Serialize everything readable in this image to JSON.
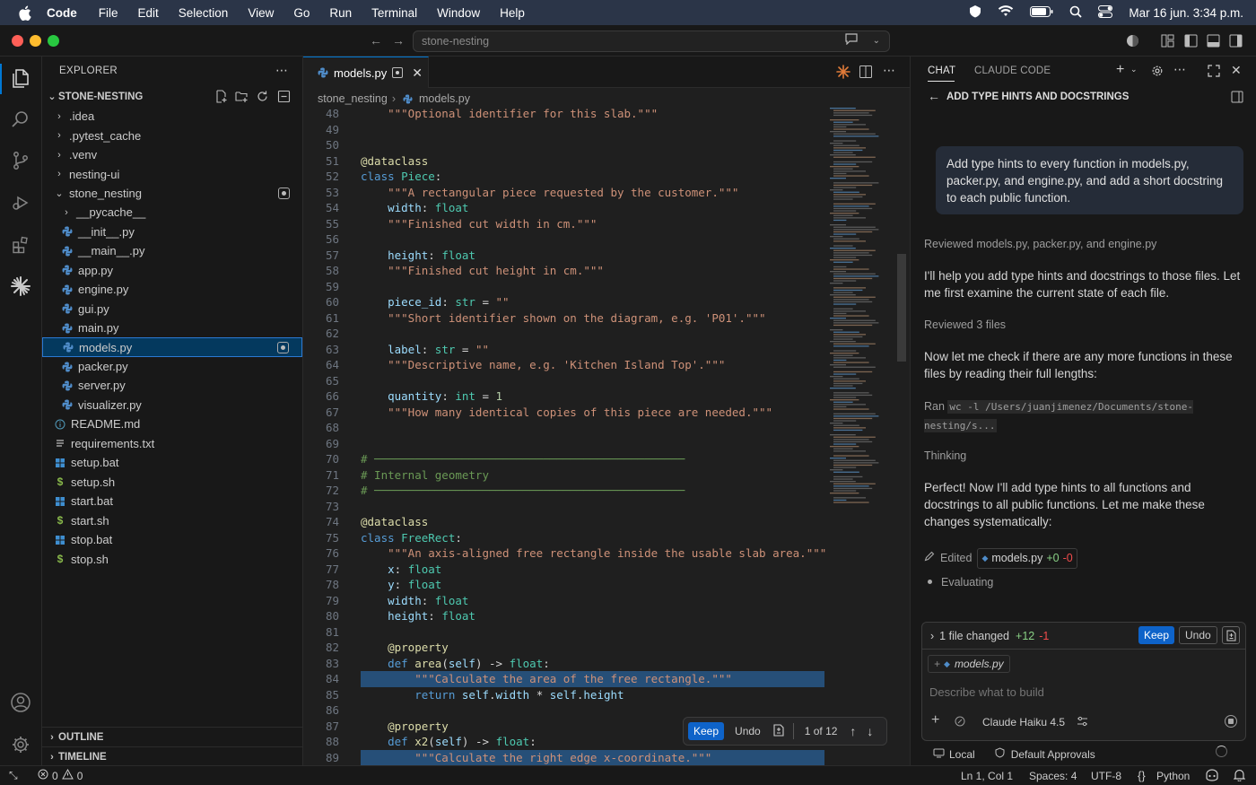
{
  "menubar": {
    "items": [
      "Code",
      "File",
      "Edit",
      "Selection",
      "View",
      "Go",
      "Run",
      "Terminal",
      "Window",
      "Help"
    ],
    "datetime": "Mar 16 jun.  3:34 p.m."
  },
  "titlebar": {
    "search": "stone-nesting"
  },
  "explorer": {
    "title": "EXPLORER",
    "root": "STONE-NESTING",
    "rows": [
      {
        "label": ".idea",
        "type": "folder",
        "depth": 1
      },
      {
        "label": ".pytest_cache",
        "type": "folder",
        "depth": 1
      },
      {
        "label": ".venv",
        "type": "folder",
        "depth": 1
      },
      {
        "label": "nesting-ui",
        "type": "folder",
        "depth": 1
      },
      {
        "label": "stone_nesting",
        "type": "folder-open",
        "depth": 1
      },
      {
        "label": "__pycache__",
        "type": "folder",
        "depth": 2
      },
      {
        "label": "__init__.py",
        "type": "py",
        "depth": 2
      },
      {
        "label": "__main__.py",
        "type": "py",
        "depth": 2
      },
      {
        "label": "app.py",
        "type": "py",
        "depth": 2
      },
      {
        "label": "engine.py",
        "type": "py",
        "depth": 2
      },
      {
        "label": "gui.py",
        "type": "py",
        "depth": 2
      },
      {
        "label": "main.py",
        "type": "py",
        "depth": 2
      },
      {
        "label": "models.py",
        "type": "py",
        "depth": 2
      },
      {
        "label": "packer.py",
        "type": "py",
        "depth": 2
      },
      {
        "label": "server.py",
        "type": "py",
        "depth": 2
      },
      {
        "label": "visualizer.py",
        "type": "py",
        "depth": 2
      },
      {
        "label": "README.md",
        "type": "info",
        "depth": 1
      },
      {
        "label": "requirements.txt",
        "type": "txt",
        "depth": 1
      },
      {
        "label": "setup.bat",
        "type": "win",
        "depth": 1
      },
      {
        "label": "setup.sh",
        "type": "sh",
        "depth": 1
      },
      {
        "label": "start.bat",
        "type": "win",
        "depth": 1
      },
      {
        "label": "start.sh",
        "type": "sh",
        "depth": 1
      },
      {
        "label": "stop.bat",
        "type": "win",
        "depth": 1
      },
      {
        "label": "stop.sh",
        "type": "sh",
        "depth": 1
      }
    ],
    "outline": "OUTLINE",
    "timeline": "TIMELINE"
  },
  "editor": {
    "tab": "models.py",
    "breadcrumb": [
      "stone_nesting",
      "models.py"
    ],
    "lines": [
      {
        "n": "48",
        "c": [
          [
            "doc",
            "    \"\"\"Optional identifier for this slab.\"\"\""
          ]
        ]
      },
      {
        "n": "49",
        "c": []
      },
      {
        "n": "50",
        "c": []
      },
      {
        "n": "51",
        "c": [
          [
            "dec",
            "@dataclass"
          ]
        ]
      },
      {
        "n": "52",
        "c": [
          [
            "k",
            "class "
          ],
          [
            "cls",
            "Piece"
          ],
          [
            "p",
            ":"
          ]
        ]
      },
      {
        "n": "53",
        "c": [
          [
            "doc",
            "    \"\"\"A rectangular piece requested by the customer.\"\"\""
          ]
        ]
      },
      {
        "n": "54",
        "c": [
          [
            "v",
            "    width"
          ],
          [
            "p",
            ": "
          ],
          [
            "ty",
            "float"
          ]
        ]
      },
      {
        "n": "55",
        "c": [
          [
            "doc",
            "    \"\"\"Finished cut width in cm.\"\"\""
          ]
        ]
      },
      {
        "n": "56",
        "c": []
      },
      {
        "n": "57",
        "c": [
          [
            "v",
            "    height"
          ],
          [
            "p",
            ": "
          ],
          [
            "ty",
            "float"
          ]
        ]
      },
      {
        "n": "58",
        "c": [
          [
            "doc",
            "    \"\"\"Finished cut height in cm.\"\"\""
          ]
        ]
      },
      {
        "n": "59",
        "c": []
      },
      {
        "n": "60",
        "c": [
          [
            "v",
            "    piece_id"
          ],
          [
            "p",
            ": "
          ],
          [
            "ty",
            "str"
          ],
          [
            "p",
            " = "
          ],
          [
            "s",
            "\"\""
          ]
        ]
      },
      {
        "n": "61",
        "c": [
          [
            "doc",
            "    \"\"\"Short identifier shown on the diagram, e.g. 'P01'.\"\"\""
          ]
        ]
      },
      {
        "n": "62",
        "c": []
      },
      {
        "n": "63",
        "c": [
          [
            "v",
            "    label"
          ],
          [
            "p",
            ": "
          ],
          [
            "ty",
            "str"
          ],
          [
            "p",
            " = "
          ],
          [
            "s",
            "\"\""
          ]
        ]
      },
      {
        "n": "64",
        "c": [
          [
            "doc",
            "    \"\"\"Descriptive name, e.g. 'Kitchen Island Top'.\"\"\""
          ]
        ]
      },
      {
        "n": "65",
        "c": []
      },
      {
        "n": "66",
        "c": [
          [
            "v",
            "    quantity"
          ],
          [
            "p",
            ": "
          ],
          [
            "ty",
            "int"
          ],
          [
            "p",
            " = "
          ],
          [
            "n",
            "1"
          ]
        ]
      },
      {
        "n": "67",
        "c": [
          [
            "doc",
            "    \"\"\"How many identical copies of this piece are needed.\"\"\""
          ]
        ]
      },
      {
        "n": "68",
        "c": []
      },
      {
        "n": "69",
        "c": []
      },
      {
        "n": "70",
        "c": [
          [
            "cm",
            "# ──────────────────────────────────────────────"
          ]
        ]
      },
      {
        "n": "71",
        "c": [
          [
            "cm",
            "# Internal geometry"
          ]
        ]
      },
      {
        "n": "72",
        "c": [
          [
            "cm",
            "# ──────────────────────────────────────────────"
          ]
        ]
      },
      {
        "n": "73",
        "c": []
      },
      {
        "n": "74",
        "c": [
          [
            "dec",
            "@dataclass"
          ]
        ]
      },
      {
        "n": "75",
        "c": [
          [
            "k",
            "class "
          ],
          [
            "cls",
            "FreeRect"
          ],
          [
            "p",
            ":"
          ]
        ]
      },
      {
        "n": "76",
        "c": [
          [
            "doc",
            "    \"\"\"An axis-aligned free rectangle inside the usable slab area.\"\"\""
          ]
        ]
      },
      {
        "n": "77",
        "c": [
          [
            "v",
            "    x"
          ],
          [
            "p",
            ": "
          ],
          [
            "ty",
            "float"
          ]
        ]
      },
      {
        "n": "78",
        "c": [
          [
            "v",
            "    y"
          ],
          [
            "p",
            ": "
          ],
          [
            "ty",
            "float"
          ]
        ]
      },
      {
        "n": "79",
        "c": [
          [
            "v",
            "    width"
          ],
          [
            "p",
            ": "
          ],
          [
            "ty",
            "float"
          ]
        ]
      },
      {
        "n": "80",
        "c": [
          [
            "v",
            "    height"
          ],
          [
            "p",
            ": "
          ],
          [
            "ty",
            "float"
          ]
        ]
      },
      {
        "n": "81",
        "c": []
      },
      {
        "n": "82",
        "c": [
          [
            "dec",
            "    @property"
          ]
        ]
      },
      {
        "n": "83",
        "c": [
          [
            "k",
            "    def "
          ],
          [
            "fn",
            "area"
          ],
          [
            "p",
            "("
          ],
          [
            "v",
            "self"
          ],
          [
            "p",
            ") -> "
          ],
          [
            "ty",
            "float"
          ],
          [
            "p",
            ":"
          ]
        ]
      },
      {
        "n": "84",
        "c": [
          [
            "doc",
            "        \"\"\"Calculate the area of the free rectangle.\"\"\""
          ]
        ],
        "hl": true
      },
      {
        "n": "85",
        "c": [
          [
            "k",
            "        return "
          ],
          [
            "v",
            "self"
          ],
          [
            "p",
            "."
          ],
          [
            "v",
            "width"
          ],
          [
            "p",
            " * "
          ],
          [
            "v",
            "self"
          ],
          [
            "p",
            "."
          ],
          [
            "v",
            "height"
          ]
        ]
      },
      {
        "n": "86",
        "c": []
      },
      {
        "n": "87",
        "c": [
          [
            "dec",
            "    @property"
          ]
        ]
      },
      {
        "n": "88",
        "c": [
          [
            "k",
            "    def "
          ],
          [
            "fn",
            "x2"
          ],
          [
            "p",
            "("
          ],
          [
            "v",
            "self"
          ],
          [
            "p",
            ") -> "
          ],
          [
            "ty",
            "float"
          ],
          [
            "p",
            ":"
          ]
        ]
      },
      {
        "n": "89",
        "c": [
          [
            "doc",
            "        \"\"\"Calculate the right edge x-coordinate.\"\"\""
          ]
        ],
        "hl": true
      }
    ],
    "keepbar": {
      "keep": "Keep",
      "undo": "Undo",
      "count": "1 of 12"
    }
  },
  "chat": {
    "tabs": [
      "CHAT",
      "CLAUDE CODE"
    ],
    "title": "ADD TYPE HINTS AND DOCSTRINGS",
    "user_msg": "Add type hints to every function in models.py, packer.py, and engine.py, and add a short docstring to each public function.",
    "reviewed1_label": "Reviewed",
    "reviewed1_files": "models.py, packer.py, and engine.py",
    "msg1": "I'll help you add type hints and docstrings to those files. Let me first examine the current state of each file.",
    "reviewed2": "Reviewed 3 files",
    "msg2": "Now let me check if there are any more functions in these files by reading their full lengths:",
    "ran_label": "Ran",
    "ran_cmd": "wc -l /Users/juanjimenez/Documents/stone-nesting/s...",
    "thinking": "Thinking",
    "msg3": "Perfect! Now I'll add type hints to all functions and docstrings to all public functions. Let me make these changes systematically:",
    "edited_label": "Edited",
    "edited_file": "models.py",
    "edited_add": "+0",
    "edited_del": "-0",
    "evaluating": "Evaluating",
    "composer": {
      "changed": "1 file changed",
      "add": "+12",
      "del": "-1",
      "keep": "Keep",
      "undo": "Undo",
      "context_file": "models.py",
      "placeholder": "Describe what to build",
      "model": "Claude Haiku 4.5"
    },
    "footer": {
      "local": "Local",
      "approvals": "Default Approvals"
    }
  },
  "statusbar": {
    "errors": "0",
    "warnings": "0",
    "position": "Ln 1, Col 1",
    "spaces": "Spaces: 4",
    "encoding": "UTF-8",
    "language": "Python"
  }
}
